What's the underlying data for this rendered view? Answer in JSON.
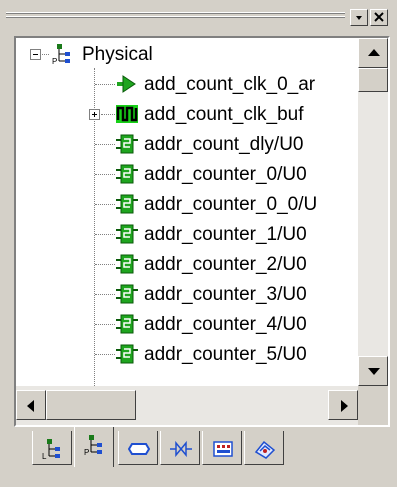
{
  "window": {
    "minimize_glyph": "▾",
    "close_glyph": "×"
  },
  "tree": {
    "root": {
      "label": "Physical",
      "icon": "physical-hierarchy-icon",
      "expanded": true
    },
    "items": [
      {
        "label": "add_count_clk_0_ar",
        "icon": "input-port-icon"
      },
      {
        "label": "add_count_clk_buf",
        "icon": "clock-buffer-icon",
        "expandable": true
      },
      {
        "label": "addr_count_dly/U0",
        "icon": "flipflop-icon"
      },
      {
        "label": "addr_counter_0/U0",
        "icon": "flipflop-icon"
      },
      {
        "label": "addr_counter_0_0/U",
        "icon": "flipflop-icon"
      },
      {
        "label": "addr_counter_1/U0",
        "icon": "flipflop-icon"
      },
      {
        "label": "addr_counter_2/U0",
        "icon": "flipflop-icon"
      },
      {
        "label": "addr_counter_3/U0",
        "icon": "flipflop-icon"
      },
      {
        "label": "addr_counter_4/U0",
        "icon": "flipflop-icon"
      },
      {
        "label": "addr_counter_5/U0",
        "icon": "flipflop-icon"
      }
    ]
  },
  "tabs": [
    {
      "icon": "logical-hierarchy-icon",
      "active": false
    },
    {
      "icon": "physical-hierarchy-icon",
      "active": true
    },
    {
      "icon": "net-icon",
      "active": false
    },
    {
      "icon": "io-buffer-icon",
      "active": false
    },
    {
      "icon": "chip-icon",
      "active": false
    },
    {
      "icon": "constraint-icon",
      "active": false
    }
  ],
  "colors": {
    "panel": "#d4d0c8",
    "tree_bg": "#ffffff",
    "icon_green": "#1fa51f",
    "buffer_bg": "#18d018"
  }
}
